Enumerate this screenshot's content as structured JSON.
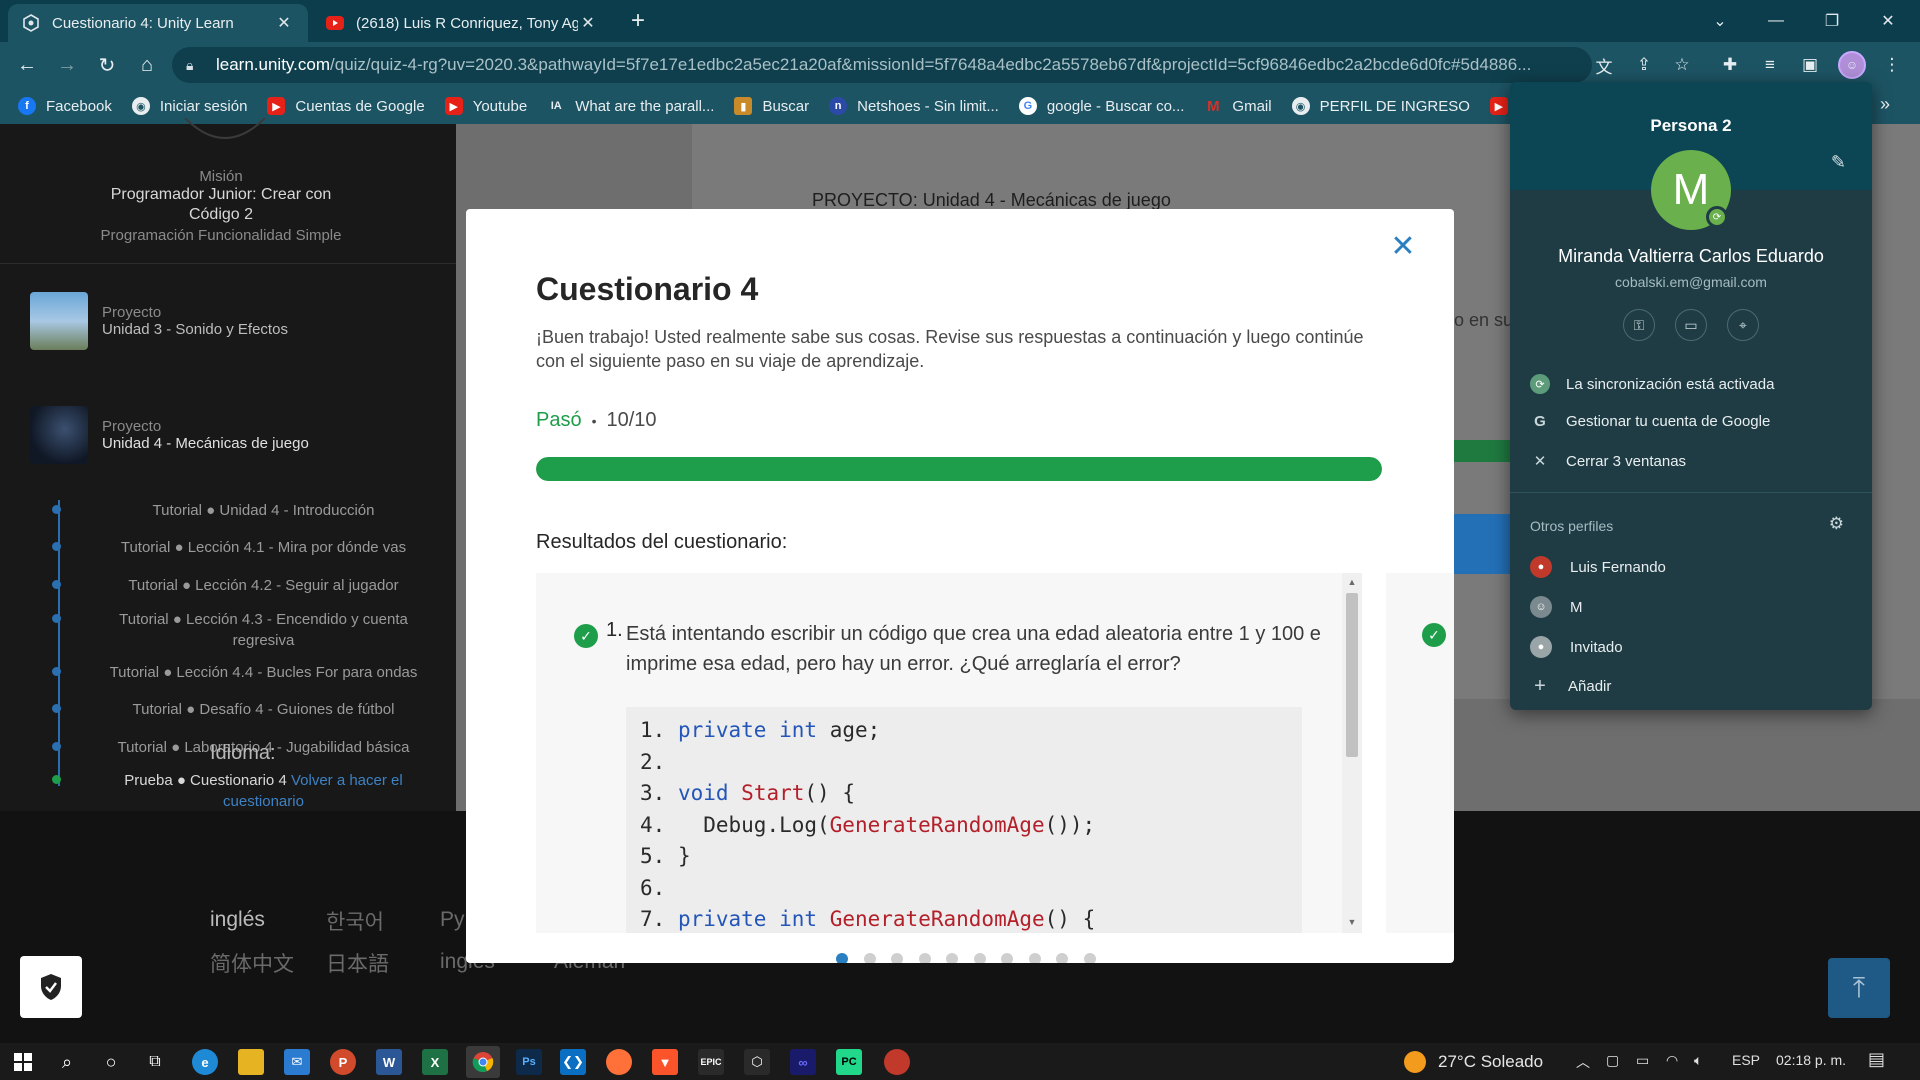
{
  "browser": {
    "tabs": [
      {
        "title": "Cuestionario 4: Unity Learn",
        "active": true
      },
      {
        "title": "(2618) Luis R Conriquez, Tony Ag",
        "active": false
      }
    ],
    "url_host": "learn.unity.com",
    "url_rest": "/quiz/quiz-4-rg?uv=2020.3&pathwayId=5f7e17e1edbc2a5ec21a20af&missionId=5f7648a4edbc2a5578eb67df&projectId=5cf96846edbc2a2bcde6d0fc#5d4886...",
    "bookmarks": [
      {
        "label": "Facebook",
        "color": "#1877f2",
        "glyph": "f"
      },
      {
        "label": "Iniciar sesión",
        "color": "#d9d9d9",
        "glyph": "●"
      },
      {
        "label": "Cuentas de Google",
        "color": "#e62117",
        "glyph": "▶"
      },
      {
        "label": "Youtube",
        "color": "#e62117",
        "glyph": "▶"
      },
      {
        "label": "What are the parall...",
        "color": "#e8eef0",
        "glyph": "IA"
      },
      {
        "label": "Buscar",
        "color": "#c98a2a",
        "glyph": "▮"
      },
      {
        "label": "Netshoes - Sin limit...",
        "color": "#2b4aa8",
        "glyph": "n"
      },
      {
        "label": "google - Buscar co...",
        "color": "#ffffff",
        "glyph": "G"
      },
      {
        "label": "Gmail",
        "color": "#d93025",
        "glyph": "M"
      },
      {
        "label": "PERFIL DE INGRESO",
        "color": "#d9d9d9",
        "glyph": "●"
      }
    ],
    "more_bookmarks": "»"
  },
  "sidebar": {
    "mision_label": "Misión",
    "mision_name": "Programador Junior: Crear con Código 2",
    "mision_sub": "Programación Funcionalidad Simple",
    "projects": [
      {
        "label": "Proyecto",
        "name": "Unidad 3 - Sonido y Efectos"
      },
      {
        "label": "Proyecto",
        "name": "Unidad 4 - Mecánicas de juego"
      }
    ],
    "tutorials": [
      "Tutorial ● Unidad 4 - Introducción",
      "Tutorial ● Lección 4.1 - Mira por dónde vas",
      "Tutorial ● Lección 4.2 - Seguir al jugador",
      "Tutorial ● Lección 4.3 - Encendido y cuenta regresiva",
      "Tutorial ● Lección 4.4 - Bucles For para ondas",
      "Tutorial ● Desafío 4 - Guiones de fútbol",
      "Tutorial ● Laboratorio 4 - Jugabilidad básica"
    ],
    "current_item": "Prueba ● Cuestionario 4",
    "retake_link": "Volver a hacer el cuestionario"
  },
  "page": {
    "project_label": "PROYECTO:  Unidad 4 - Mecánicas de juego",
    "ghost_text": "o en su",
    "idioma_label": "Idioma:",
    "languages": [
      "inglés",
      "한국어",
      "Ру",
      "简体中文",
      "日本語",
      "inglés",
      "Alemán"
    ]
  },
  "modal": {
    "title": "Cuestionario 4",
    "intro": "¡Buen trabajo! Usted realmente sabe sus cosas. Revise sus respuestas a continuación y luego continúe con el siguiente paso en su viaje de aprendizaje.",
    "status": "Pasó",
    "separator": "•",
    "score": "10/10",
    "progress_fraction": 1.0,
    "results_label": "Resultados del cuestionario:",
    "question_number": "1.",
    "question_text": "Está intentando escribir un código que crea una edad aleatoria entre 1 y 100 e imprime esa edad, pero hay un error. ¿Qué arreglaría el error?",
    "code_lines": [
      {
        "n": "1.",
        "parts": [
          {
            "t": "private",
            "c": "kw"
          },
          {
            "t": " ",
            "c": ""
          },
          {
            "t": "int",
            "c": "kw"
          },
          {
            "t": " age;",
            "c": ""
          }
        ]
      },
      {
        "n": "2.",
        "parts": []
      },
      {
        "n": "3.",
        "parts": [
          {
            "t": "void",
            "c": "kw"
          },
          {
            "t": " ",
            "c": ""
          },
          {
            "t": "Start",
            "c": "fn"
          },
          {
            "t": "() {",
            "c": ""
          }
        ]
      },
      {
        "n": "4.",
        "parts": [
          {
            "t": "  Debug.Log(",
            "c": ""
          },
          {
            "t": "GenerateRandomAge",
            "c": "fn"
          },
          {
            "t": "());",
            "c": ""
          }
        ]
      },
      {
        "n": "5.",
        "parts": [
          {
            "t": "}",
            "c": ""
          }
        ]
      },
      {
        "n": "6.",
        "parts": []
      },
      {
        "n": "7.",
        "parts": [
          {
            "t": "private",
            "c": "kw"
          },
          {
            "t": " ",
            "c": ""
          },
          {
            "t": "int",
            "c": "kw"
          },
          {
            "t": " ",
            "c": ""
          },
          {
            "t": "GenerateRandomAge",
            "c": "fn"
          },
          {
            "t": "() {",
            "c": ""
          }
        ]
      }
    ],
    "pagination_count": 10,
    "pagination_active": 0
  },
  "profile": {
    "title": "Persona 2",
    "avatar_letter": "M",
    "name": "Miranda Valtierra Carlos Eduardo",
    "email": "cobalski.em@gmail.com",
    "sync": "La sincronización está activada",
    "manage": "Gestionar tu cuenta de Google",
    "close": "Cerrar 3 ventanas",
    "otros_label": "Otros perfiles",
    "others": [
      {
        "name": "Luis Fernando",
        "color": "#c0392b"
      },
      {
        "name": "M",
        "color": "#7a8a8f"
      },
      {
        "name": "Invitado",
        "color": "#9aa5a8"
      }
    ],
    "add": "Añadir"
  },
  "taskbar": {
    "weather": "27°C  Soleado",
    "lang": "ESP",
    "time": "02:18 p. m."
  },
  "colors": {
    "accent_green": "#1e9e4a",
    "link_blue": "#2a7fc0",
    "chrome_teal": "#1d5464"
  }
}
